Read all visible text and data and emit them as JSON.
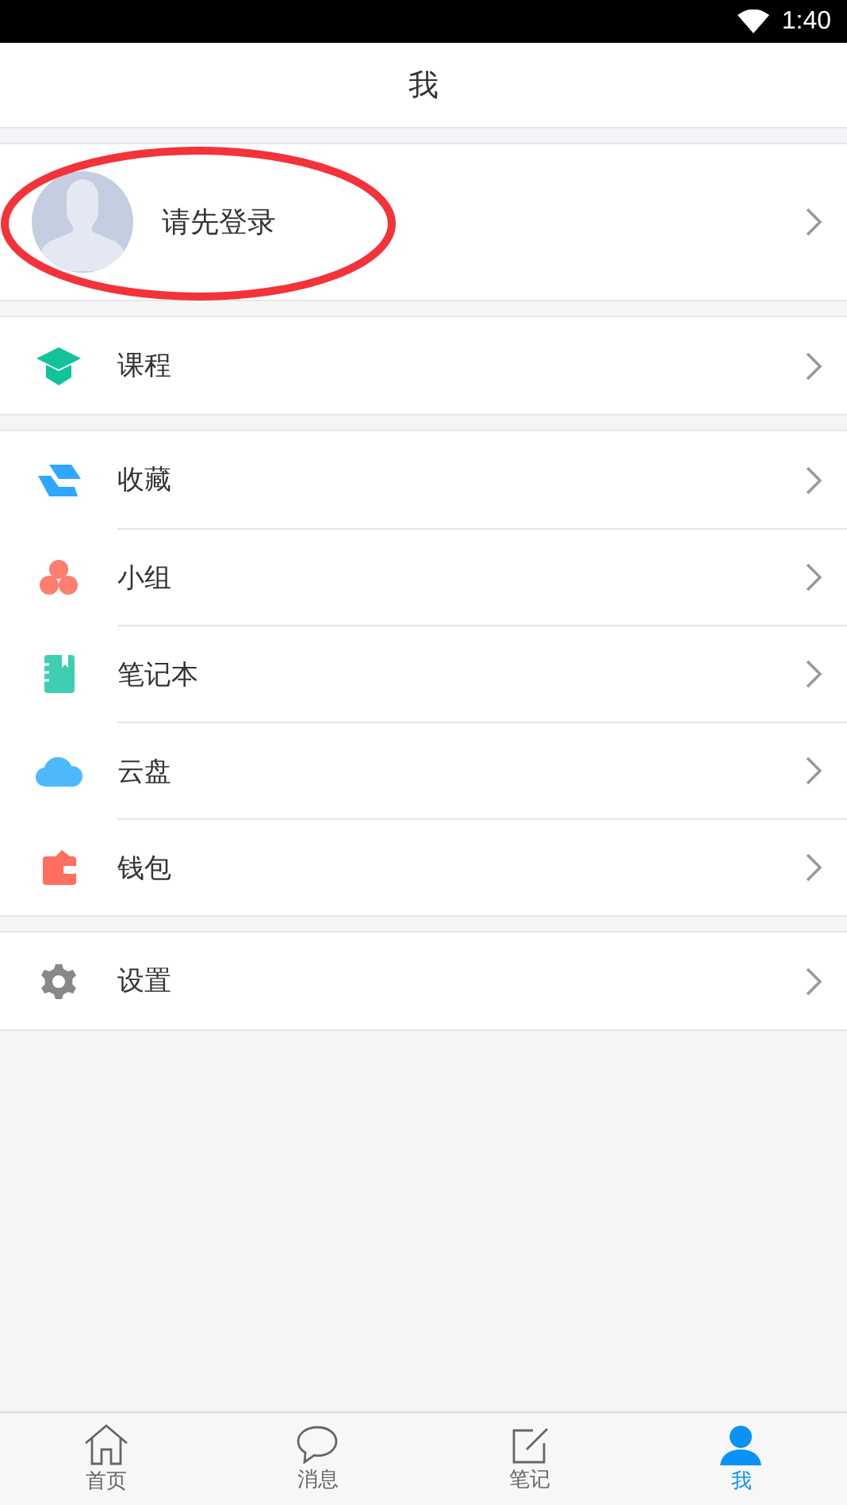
{
  "status_bar": {
    "time": "1:40"
  },
  "header": {
    "title": "我"
  },
  "profile": {
    "label": "请先登录"
  },
  "sections": [
    [
      {
        "label": "课程"
      }
    ],
    [
      {
        "label": "收藏"
      },
      {
        "label": "小组"
      },
      {
        "label": "笔记本"
      },
      {
        "label": "云盘"
      },
      {
        "label": "钱包"
      }
    ],
    [
      {
        "label": "设置"
      }
    ]
  ],
  "tabs": [
    {
      "label": "首页",
      "selected": false
    },
    {
      "label": "消息",
      "selected": false
    },
    {
      "label": "笔记",
      "selected": false
    },
    {
      "label": "我",
      "selected": true
    }
  ]
}
